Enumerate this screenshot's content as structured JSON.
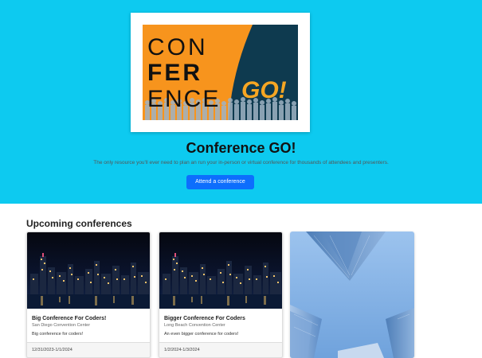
{
  "hero": {
    "logo": {
      "line1": "CON",
      "line2": "FER",
      "line3": "ENCE",
      "go": "GO!"
    },
    "title": "Conference GO!",
    "subtitle": "The only resource you'll ever need to plan an run your in-person or virtual conference for thousands of attendees and presenters.",
    "cta_label": "Attend a conference"
  },
  "section": {
    "title": "Upcoming conferences"
  },
  "conferences": [
    {
      "name": "Big Conference For Coders!",
      "location": "San Diego Convention Center",
      "description": "Big conference for coders!",
      "dates": "12/31/2023-1/1/2024"
    },
    {
      "name": "Bigger Conference For Coders",
      "location": "Long Beach Convention Center",
      "description": "An even bigger conference for coders!",
      "dates": "1/2/2024-1/3/2024"
    }
  ],
  "colors": {
    "hero_bg": "#0dcaf0",
    "primary_button": "#0d6efd",
    "logo_orange": "#f7941d",
    "logo_navy": "#0e3a4f",
    "logo_yellow": "#f5a623"
  }
}
